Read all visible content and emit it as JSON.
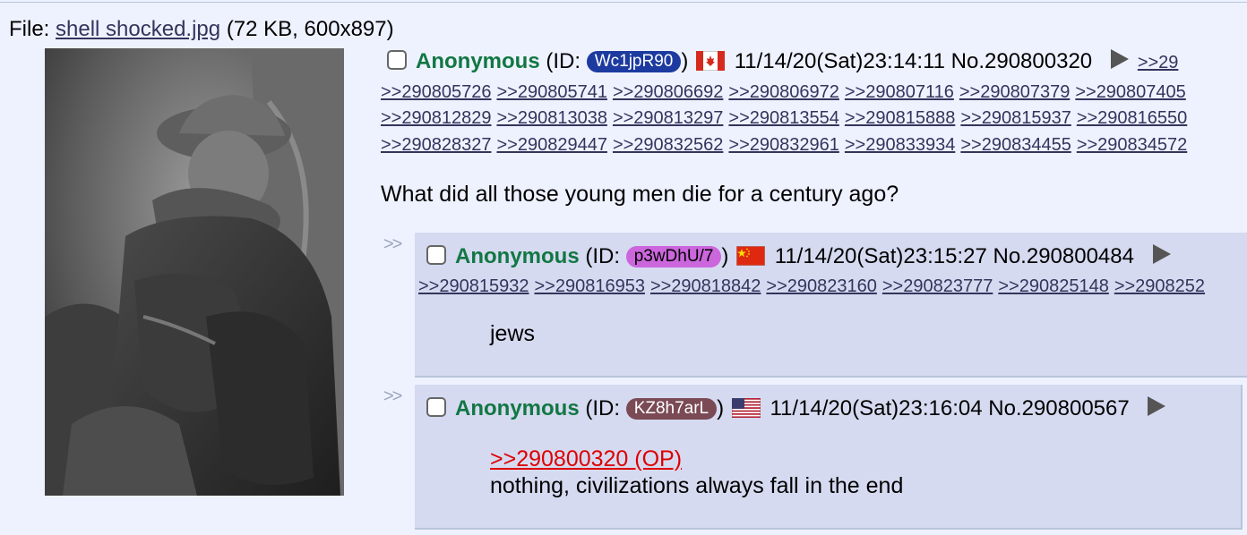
{
  "file": {
    "prefix": "File:",
    "name": "shell shocked.jpg",
    "meta": "(72 KB, 600x897)"
  },
  "op": {
    "name": "Anonymous",
    "id_prefix": "(ID:",
    "id": "Wc1jpR90",
    "id_suffix": ")",
    "id_color": "#1c3aa0",
    "flag": "canada-flag",
    "datetime": "11/14/20(Sat)23:14:11",
    "number": "No.290800320",
    "backlink_partial": ">>29",
    "backlinks_row1": [
      ">>290805726",
      ">>290805741",
      ">>290806692",
      ">>290806972",
      ">>290807116",
      ">>290807379",
      ">>290807405"
    ],
    "backlinks_row2": [
      ">>290812829",
      ">>290813038",
      ">>290813297",
      ">>290813554",
      ">>290815888",
      ">>290815937",
      ">>290816550"
    ],
    "backlinks_row3": [
      ">>290828327",
      ">>290829447",
      ">>290832562",
      ">>290832961",
      ">>290833934",
      ">>290834455",
      ">>290834572"
    ],
    "message": "What did all those young men die for a century ago?"
  },
  "replies": [
    {
      "arrows": ">>",
      "name": "Anonymous",
      "id_prefix": "(ID:",
      "id": "p3wDhU/7",
      "id_suffix": ")",
      "id_color": "#cc66dd",
      "id_text_color": "#000000",
      "flag": "china-flag",
      "datetime": "11/14/20(Sat)23:15:27",
      "number": "No.290800484",
      "backlinks": [
        ">>290815932",
        ">>290816953",
        ">>290818842",
        ">>290823160",
        ">>290823777",
        ">>290825148",
        ">>2908252"
      ],
      "quote": "",
      "message": "jews"
    },
    {
      "arrows": ">>",
      "name": "Anonymous",
      "id_prefix": "(ID:",
      "id": "KZ8h7arL",
      "id_suffix": ")",
      "id_color": "#7a4a55",
      "id_text_color": "#ffffff",
      "flag": "usa-flag",
      "datetime": "11/14/20(Sat)23:16:04",
      "number": "No.290800567",
      "backlinks": [],
      "quote": ">>290800320 (OP)",
      "message": "nothing, civilizations always fall in the end"
    }
  ]
}
